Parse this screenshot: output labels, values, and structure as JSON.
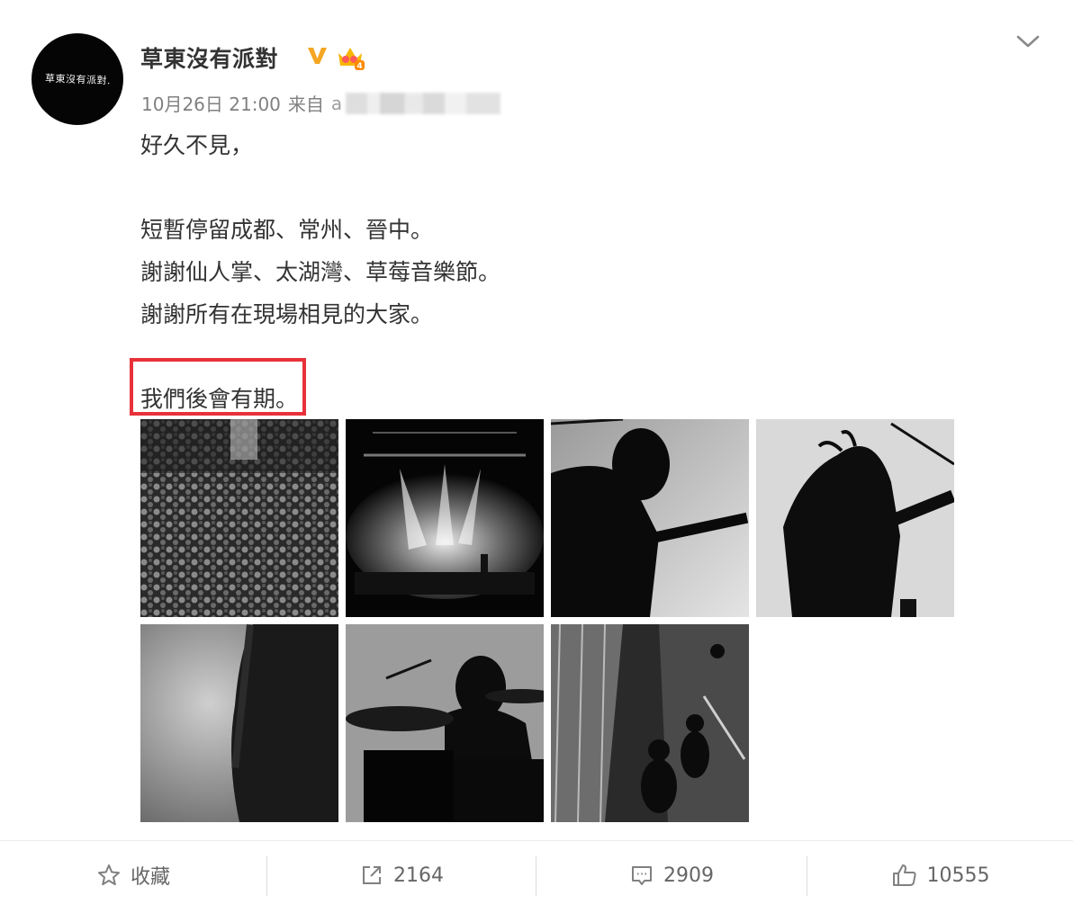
{
  "post": {
    "avatar_text": "草東沒有派對.",
    "username": "草東沒有派對",
    "timestamp": "10月26日 21:00",
    "source_prefix": "来自",
    "source_visible_char": "a",
    "lines": [
      "好久不見，",
      "",
      "短暫停留成都、常州、晉中。",
      "謝謝仙人掌、太湖灣、草莓音樂節。",
      "謝謝所有在現場相見的大家。",
      "",
      "我們後會有期。"
    ],
    "highlight_color": "#e8323a",
    "badges": {
      "verified": "V",
      "verified_color": "#f5a623",
      "crown_level": "4"
    }
  },
  "photos": [
    {
      "name": "photo-crowd"
    },
    {
      "name": "photo-stage-lights"
    },
    {
      "name": "photo-guitarist-silhouette"
    },
    {
      "name": "photo-guitarist-hair"
    },
    {
      "name": "photo-bassist-smoke"
    },
    {
      "name": "photo-drummer"
    },
    {
      "name": "photo-backstage"
    }
  ],
  "actions": {
    "favorite_label": "收藏",
    "repost_count": "2164",
    "comment_count": "2909",
    "like_count": "10555"
  },
  "icons": [
    "chevron-down-icon",
    "star-icon",
    "share-icon",
    "comment-icon",
    "thumbs-up-icon",
    "verified-icon",
    "crown-icon"
  ]
}
